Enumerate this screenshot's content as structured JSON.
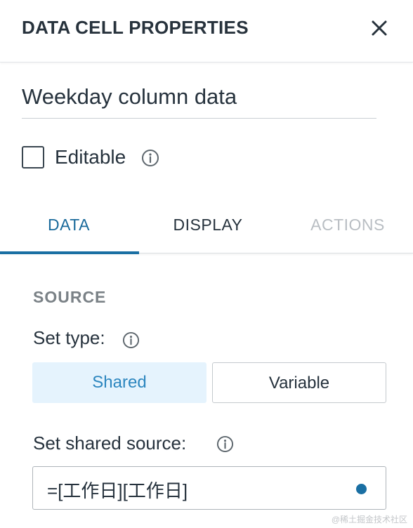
{
  "header": {
    "title": "DATA CELL PROPERTIES",
    "close_icon": "close-icon"
  },
  "name_field": {
    "value": "Weekday column data"
  },
  "editable": {
    "label": "Editable",
    "checked": false,
    "info_icon": "info-icon"
  },
  "tabs": [
    {
      "label": "DATA",
      "state": "active"
    },
    {
      "label": "DISPLAY",
      "state": "normal"
    },
    {
      "label": "ACTIONS",
      "state": "disabled"
    }
  ],
  "source": {
    "heading": "SOURCE",
    "set_type_label": "Set type:",
    "type_options": [
      "Shared",
      "Variable"
    ],
    "selected_type": "Shared",
    "shared_source_label": "Set shared source:",
    "shared_source_value": "=[工作日][工作日]"
  },
  "watermark": "@稀土掘金技术社区",
  "colors": {
    "accent": "#1a6fa3",
    "shared_bg": "#e5f3fd",
    "shared_text": "#2c86bf",
    "text": "#26323d",
    "muted": "#7a8186",
    "disabled": "#b9bec3"
  }
}
